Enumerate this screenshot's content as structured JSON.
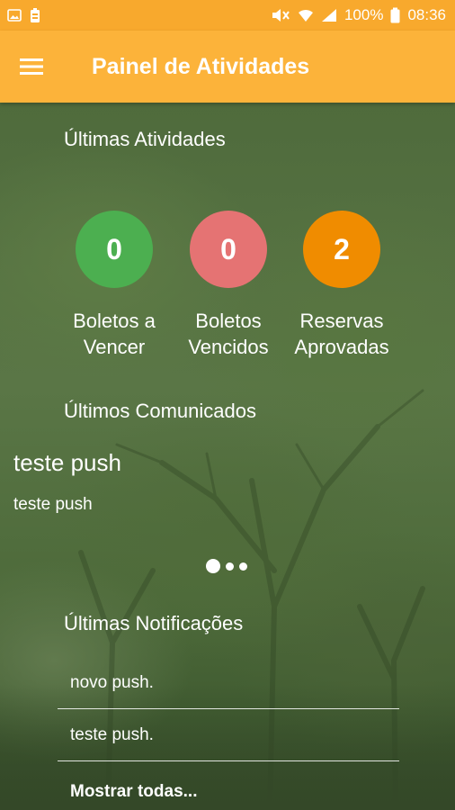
{
  "status_bar": {
    "battery_percent": "100%",
    "time": "08:36",
    "icons_left": [
      "image-icon",
      "battery-saver-icon"
    ],
    "icons_right": [
      "mute-icon",
      "wifi-icon",
      "signal-icon",
      "battery-icon"
    ]
  },
  "app_bar": {
    "title": "Painel de Atividades",
    "color": "#fcb33a"
  },
  "activities": {
    "title": "Últimas Atividades",
    "stats": [
      {
        "value": "0",
        "label_line1": "Boletos a",
        "label_line2": "Vencer",
        "color": "#4caf50"
      },
      {
        "value": "0",
        "label_line1": "Boletos",
        "label_line2": "Vencidos",
        "color": "#e57373"
      },
      {
        "value": "2",
        "label_line1": "Reservas",
        "label_line2": "Aprovadas",
        "color": "#f08c00"
      }
    ]
  },
  "announcements": {
    "title": "Últimos Comunicados",
    "current": {
      "heading": "teste push",
      "body": "teste push"
    },
    "pages": 3,
    "active_page": 1
  },
  "notifications": {
    "title": "Últimas Notificações",
    "items": [
      "novo push.",
      "teste push."
    ],
    "show_all": "Mostrar todas..."
  }
}
